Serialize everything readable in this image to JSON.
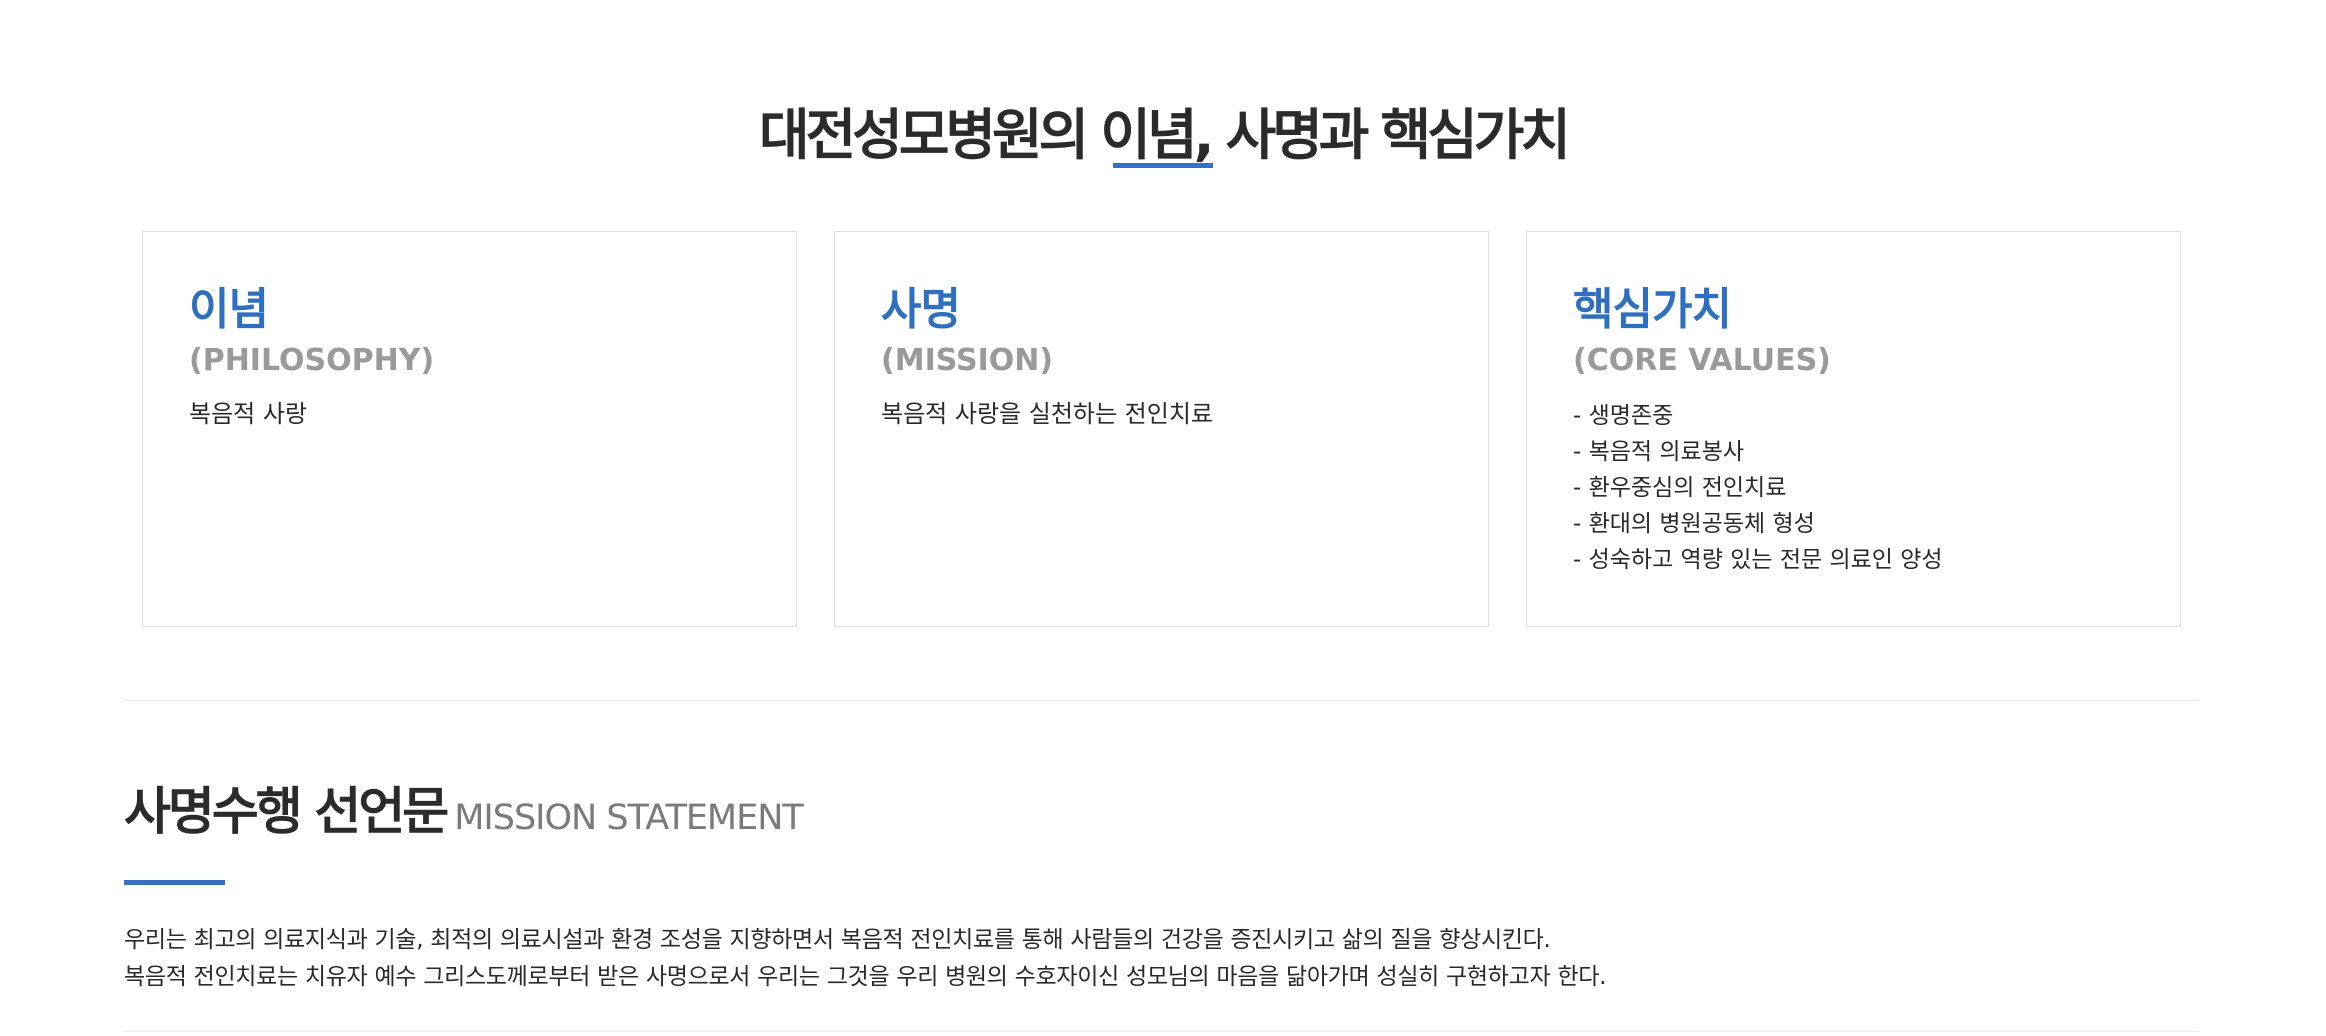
{
  "header": {
    "title": "대전성모병원의 이념, 사명과 핵심가치"
  },
  "cards": [
    {
      "title": "이념",
      "subtitle": "(PHILOSOPHY)",
      "body": "복음적 사랑"
    },
    {
      "title": "사명",
      "subtitle": "(MISSION)",
      "body": "복음적 사랑을 실천하는 전인치료"
    },
    {
      "title": "핵심가치",
      "subtitle": "(CORE VALUES)",
      "items": [
        "- 생명존중",
        "- 복음적 의료봉사",
        "- 환우중심의 전인치료",
        "- 환대의 병원공동체 형성",
        "- 성숙하고 역량 있는 전문 의료인 양성"
      ]
    }
  ],
  "mission_statement": {
    "title_ko": "사명수행 선언문",
    "title_en": "MISSION STATEMENT",
    "lines": [
      "우리는 최고의 의료지식과 기술, 최적의 의료시설과 환경 조성을 지향하면서 복음적 전인치료를 통해 사람들의 건강을 증진시키고 삶의 질을 향상시킨다.",
      "복음적 전인치료는 치유자 예수 그리스도께로부터 받은 사명으로서 우리는 그것을 우리 병원의 수호자이신 성모님의 마음을 닮아가며 성실히 구현하고자 한다."
    ]
  },
  "colors": {
    "accent": "#3471c4",
    "card_heading": "#2f6fbf",
    "subtitle_gray": "#9a9a9a",
    "text": "#2a2a2a"
  }
}
